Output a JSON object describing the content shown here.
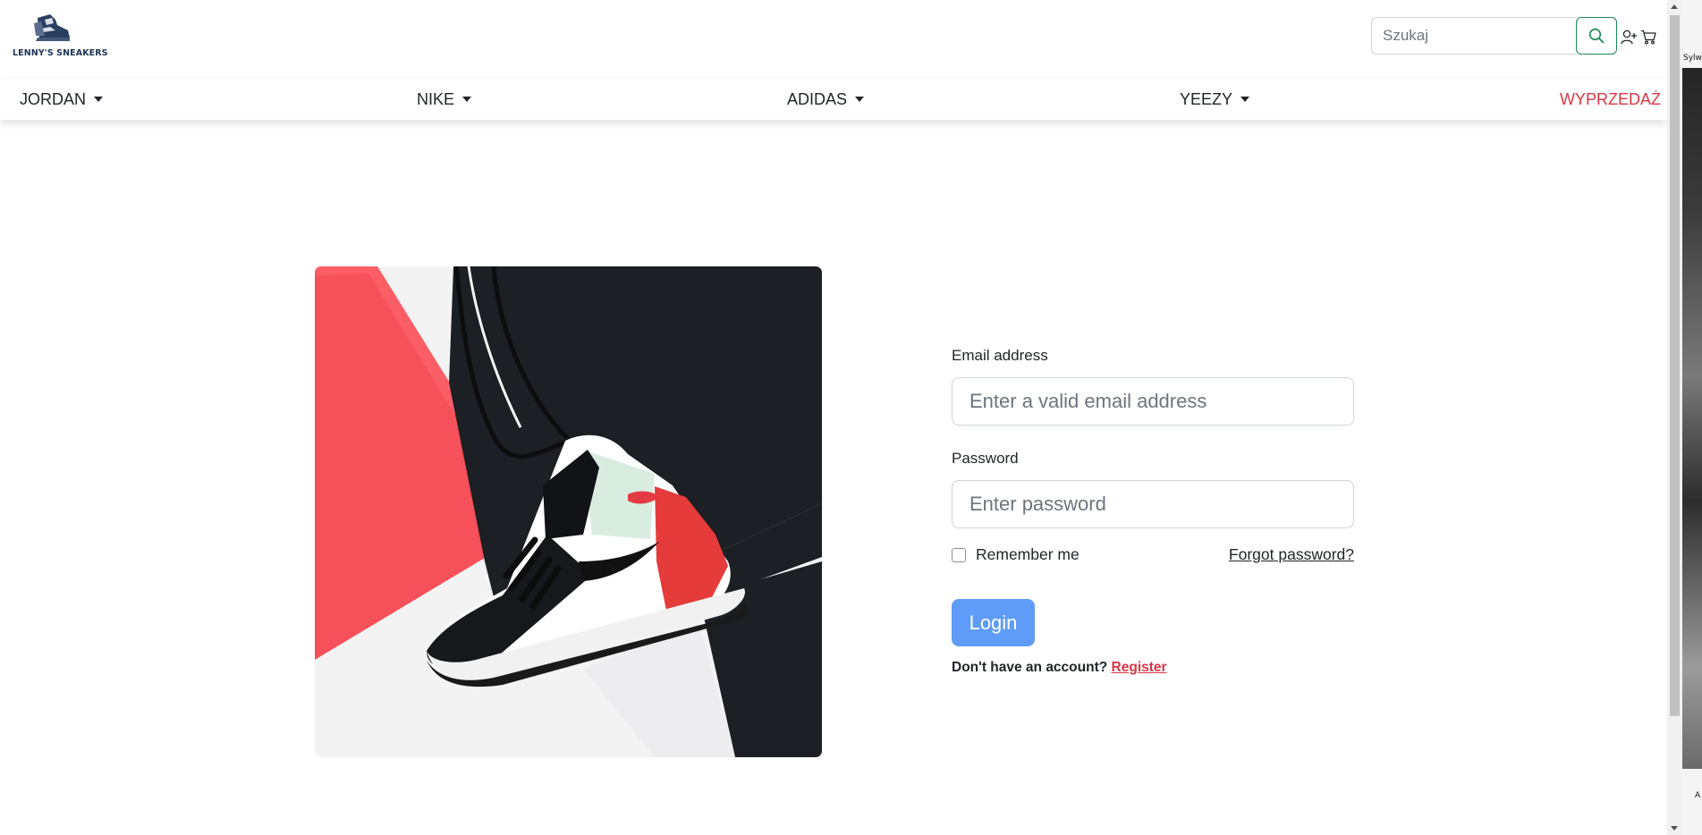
{
  "header": {
    "logo_text": "LENNY'S SNEAKERS",
    "search": {
      "placeholder": "Szukaj"
    },
    "icons": {
      "search": "search-icon",
      "account": "person-plus-icon",
      "cart": "cart-icon"
    }
  },
  "nav": {
    "items": [
      {
        "label": "JORDAN",
        "dropdown": true
      },
      {
        "label": "NIKE",
        "dropdown": true
      },
      {
        "label": "ADIDAS",
        "dropdown": true
      },
      {
        "label": "YEEZY",
        "dropdown": true
      },
      {
        "label": "WYPRZEDAŻ",
        "dropdown": false,
        "color": "#dc3545"
      }
    ]
  },
  "hero": {
    "image": "sneaker-photo",
    "colors": {
      "red": "#f6505a",
      "black": "#1c1f23",
      "white": "#f4f4f5"
    }
  },
  "login": {
    "email_label": "Email address",
    "email_placeholder": "Enter a valid email address",
    "password_label": "Password",
    "password_placeholder": "Enter password",
    "remember_label": "Remember me",
    "remember_checked": false,
    "forgot_label": "Forgot password?",
    "login_button": "Login",
    "register_prompt": "Don't have an account?",
    "register_link": "Register",
    "accent": "#5e9cf7"
  },
  "side_strip": {
    "top_text": "Sylw",
    "bottom_text": "A"
  }
}
